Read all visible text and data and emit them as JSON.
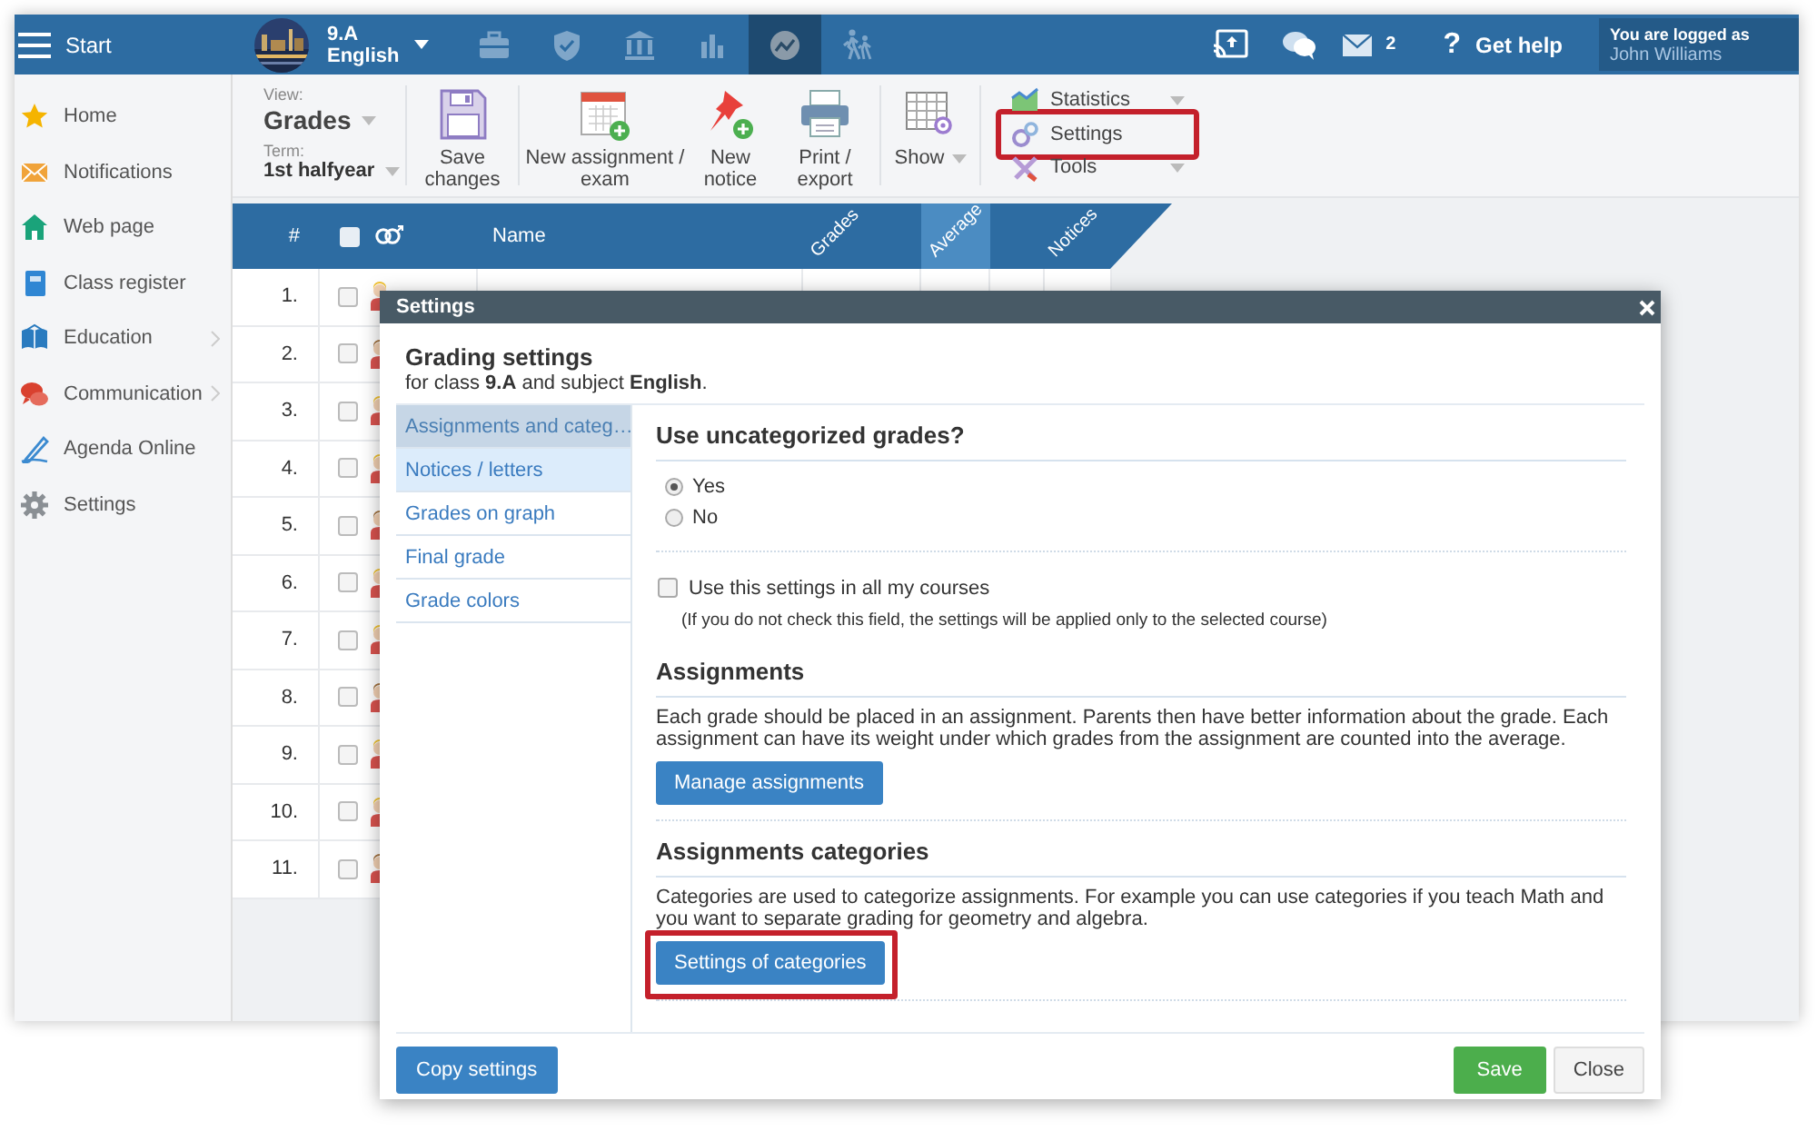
{
  "topbar": {
    "menu_label": "Start",
    "class_name": "9.A",
    "subject": "English",
    "nav": [
      {
        "kind": "briefcase",
        "selected": false
      },
      {
        "kind": "shield",
        "selected": false
      },
      {
        "kind": "bank",
        "selected": false
      },
      {
        "kind": "bars",
        "selected": false
      },
      {
        "kind": "chart",
        "selected": true
      },
      {
        "kind": "walkers",
        "selected": false
      }
    ],
    "mail_count": "2",
    "help_glyph": "?",
    "help": "Get help",
    "login_caption": "You are logged as",
    "user": "John Williams"
  },
  "sidebar": {
    "items": [
      {
        "label": "Home",
        "kind": "star",
        "submenu": false
      },
      {
        "label": "Notifications",
        "kind": "envelope",
        "submenu": false
      },
      {
        "label": "Web page",
        "kind": "house",
        "submenu": false
      },
      {
        "label": "Class register",
        "kind": "notebook",
        "submenu": false
      },
      {
        "label": "Education",
        "kind": "book",
        "submenu": true
      },
      {
        "label": "Communication",
        "kind": "chat",
        "submenu": true
      },
      {
        "label": "Agenda Online",
        "kind": "pen",
        "submenu": false
      },
      {
        "label": "Settings",
        "kind": "gear",
        "submenu": false
      }
    ]
  },
  "toolbar": {
    "view_label": "View:",
    "view": "Grades",
    "term_label": "Term:",
    "term": "1st halfyear",
    "buttons": [
      {
        "kind": "save",
        "label": "Save changes"
      },
      {
        "kind": "assignment",
        "label": "New assignment / exam"
      },
      {
        "kind": "notice",
        "label": "New notice"
      },
      {
        "kind": "print",
        "label": "Print / export"
      },
      {
        "kind": "show",
        "label": "Show"
      }
    ],
    "menu": [
      {
        "kind": "statistics",
        "label": "Statistics",
        "dropdown": true,
        "highlighted": false
      },
      {
        "kind": "settings",
        "label": "Settings",
        "dropdown": false,
        "highlighted": true
      },
      {
        "kind": "tools",
        "label": "Tools",
        "dropdown": true,
        "highlighted": false
      }
    ]
  },
  "table": {
    "columns": [
      {
        "kind": "number",
        "label": "#"
      },
      {
        "kind": "checkbox",
        "checked": false
      },
      {
        "kind": "gender"
      },
      {
        "kind": "name",
        "label": "Name"
      },
      {
        "kind": "rotated",
        "label": "Grades",
        "selected": false
      },
      {
        "kind": "rotated",
        "label": "Average",
        "selected": true
      },
      {
        "kind": "rotated",
        "label": "Notices",
        "selected": false
      }
    ],
    "rows": [
      {
        "number": "1.",
        "checked": false,
        "kind": "blond"
      },
      {
        "number": "2.",
        "checked": false,
        "kind": "dark"
      },
      {
        "number": "3.",
        "checked": false,
        "kind": "blond"
      },
      {
        "number": "4.",
        "checked": false,
        "kind": "blond"
      },
      {
        "number": "5.",
        "checked": false,
        "kind": "dark"
      },
      {
        "number": "6.",
        "checked": false,
        "kind": "blond"
      },
      {
        "number": "7.",
        "checked": false,
        "kind": "blond"
      },
      {
        "number": "8.",
        "checked": false,
        "kind": "dark"
      },
      {
        "number": "9.",
        "checked": false,
        "kind": "blond"
      },
      {
        "number": "10.",
        "checked": false,
        "kind": "blond"
      },
      {
        "number": "11.",
        "checked": false,
        "kind": "dark"
      }
    ]
  },
  "dialog": {
    "title": "Settings",
    "heading": "Grading settings",
    "subheading": "for class **9.A** and subject **English**.",
    "nav": [
      {
        "label": "Assignments and categ…",
        "selected": true,
        "hovered": false
      },
      {
        "label": "Notices / letters",
        "selected": false,
        "hovered": true
      },
      {
        "label": "Grades on graph",
        "selected": false,
        "hovered": false
      },
      {
        "label": "Final grade",
        "selected": false,
        "hovered": false
      },
      {
        "label": "Grade colors",
        "selected": false,
        "hovered": false
      }
    ],
    "sections": [
      {
        "kind": "radio",
        "title": "Use uncategorized grades?",
        "options": [
          {
            "label": "Yes",
            "selected": true
          },
          {
            "label": "No",
            "selected": false
          }
        ]
      },
      {
        "kind": "checkbox",
        "label": "Use this settings in all my courses",
        "checked": false,
        "note": "(If you do not check this field, the settings will be applied only to the selected course)"
      },
      {
        "kind": "action",
        "title": "Assignments",
        "text": "Each grade should be placed in an assignment. Parents then have better information about the grade. Each assignment can have its weight under which grades from the assignment are counted into the average.",
        "button": "Manage assignments",
        "highlighted": false
      },
      {
        "kind": "action",
        "title": "Assignments categories",
        "text": "Categories are used to categorize assignments. For example you can use categories if you teach Math and you want to separate grading for geometry and algebra.",
        "button": "Settings of categories",
        "highlighted": true
      }
    ],
    "footer": {
      "copy": "Copy settings",
      "save": "Save",
      "close": "Close"
    }
  }
}
